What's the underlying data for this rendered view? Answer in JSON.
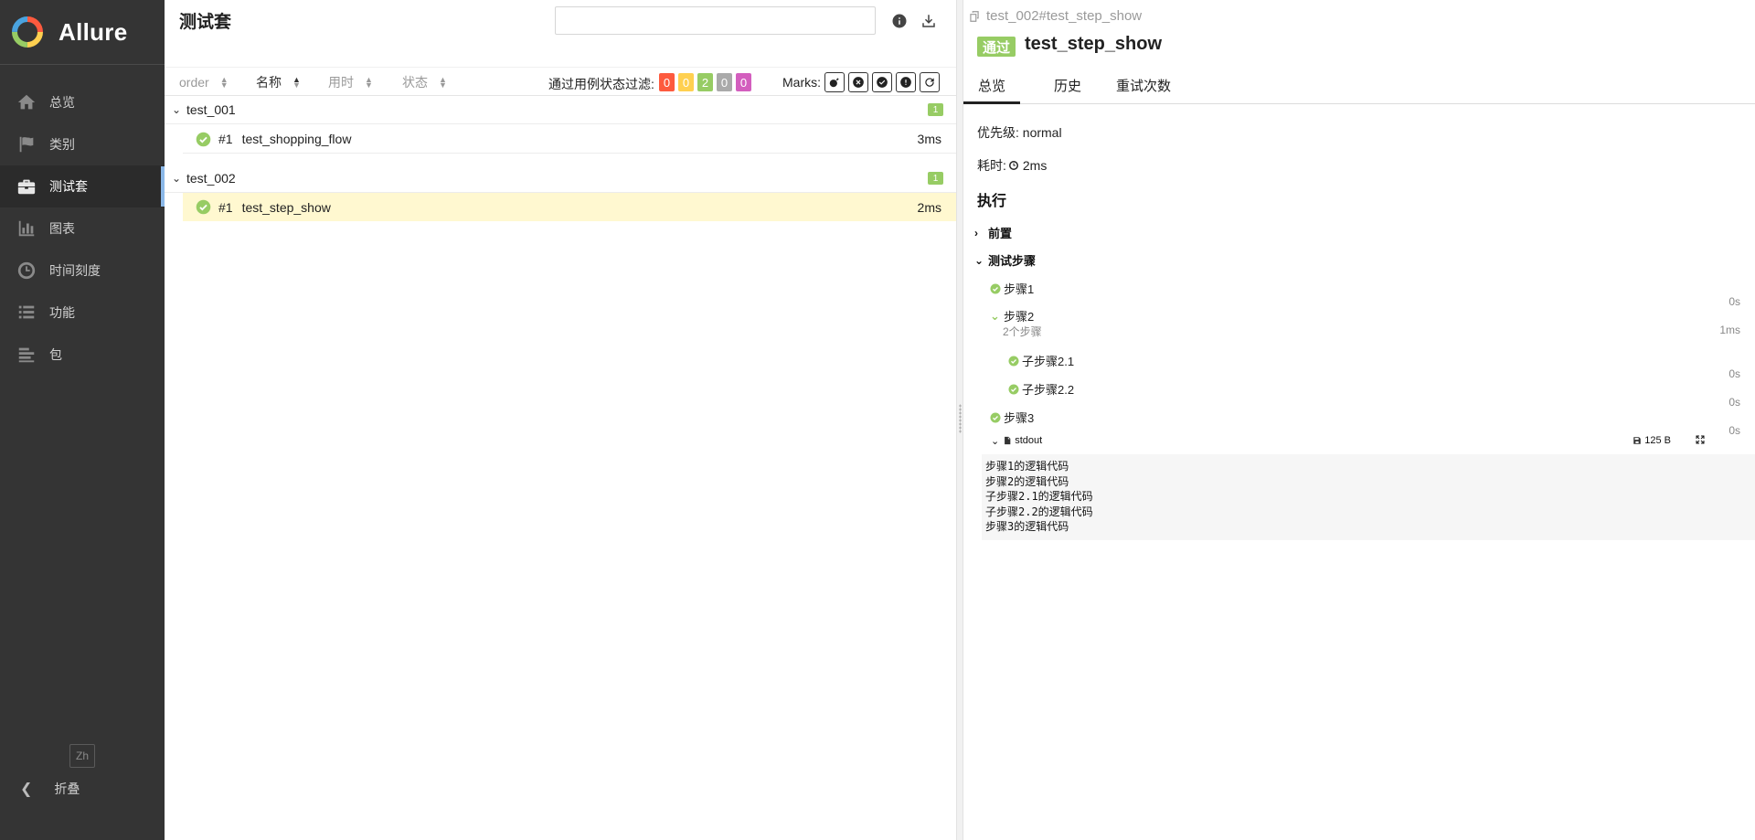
{
  "sidebar": {
    "brand": "Allure",
    "items": [
      {
        "label": "总览",
        "icon": "home-icon"
      },
      {
        "label": "类别",
        "icon": "flag-icon"
      },
      {
        "label": "测试套",
        "icon": "briefcase-icon",
        "active": true
      },
      {
        "label": "图表",
        "icon": "bar-chart-icon"
      },
      {
        "label": "时间刻度",
        "icon": "clock-icon"
      },
      {
        "label": "功能",
        "icon": "list-icon"
      },
      {
        "label": "包",
        "icon": "align-left-icon"
      }
    ],
    "language": "Zh",
    "collapse_label": "折叠"
  },
  "suites": {
    "title": "测试套",
    "search": {
      "value": "",
      "placeholder": ""
    },
    "sort_columns": [
      {
        "label": "order"
      },
      {
        "label": "名称",
        "selected": true
      },
      {
        "label": "用时"
      },
      {
        "label": "状态"
      }
    ],
    "filter_label": "通过用例状态过滤:",
    "status_counts": [
      {
        "value": "0",
        "status": "failed",
        "color": "#fd5a3e"
      },
      {
        "value": "0",
        "status": "broken",
        "color": "#ffd050"
      },
      {
        "value": "2",
        "status": "passed",
        "color": "#97cc64"
      },
      {
        "value": "0",
        "status": "skipped",
        "color": "#aaaaaa"
      },
      {
        "value": "0",
        "status": "unknown",
        "color": "#d35ebe"
      }
    ],
    "marks_label": "Marks:",
    "groups": [
      {
        "name": "test_001",
        "count": "1",
        "cases": [
          {
            "num": "#1",
            "name": "test_shopping_flow",
            "duration": "3ms",
            "status": "passed"
          }
        ]
      },
      {
        "name": "test_002",
        "count": "1",
        "cases": [
          {
            "num": "#1",
            "name": "test_step_show",
            "duration": "2ms",
            "status": "passed",
            "selected": true
          }
        ]
      }
    ]
  },
  "detail": {
    "breadcrumb": "test_002#test_step_show",
    "status_label": "通过",
    "title": "test_step_show",
    "tabs": [
      "总览",
      "历史",
      "重试次数"
    ],
    "active_tab": "总览",
    "severity_label": "优先级: normal",
    "duration_label": "耗时:",
    "duration_value": "2ms",
    "execution_label": "执行",
    "setup_label": "前置",
    "steps_label": "测试步骤",
    "steps": [
      {
        "name": "步骤1",
        "duration": "0s"
      },
      {
        "name": "步骤2",
        "sub": "2个步骤",
        "duration": "1ms",
        "children": [
          {
            "name": "子步骤2.1",
            "duration": "0s"
          },
          {
            "name": "子步骤2.2",
            "duration": "0s"
          }
        ]
      },
      {
        "name": "步骤3",
        "duration": "0s"
      }
    ],
    "attachment": {
      "name": "stdout",
      "size": "125 B"
    },
    "stdout_lines": [
      "步骤1的逻辑代码",
      "步骤2的逻辑代码",
      "子步骤2.1的逻辑代码",
      "子步骤2.2的逻辑代码",
      "步骤3的逻辑代码"
    ]
  },
  "colors": {
    "sidebar": "#343434",
    "passed": "#97cc64",
    "selected_row": "#fff8d0"
  }
}
